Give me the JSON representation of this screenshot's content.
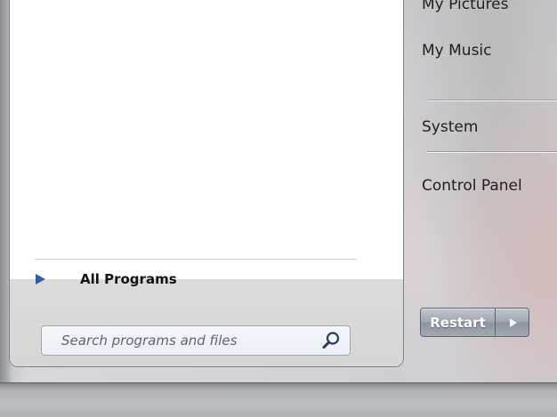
{
  "start_menu": {
    "all_programs_label": "All Programs",
    "search": {
      "placeholder": "Search programs and files",
      "value": ""
    },
    "right_items": {
      "my_pictures": "My Pictures",
      "my_music": "My Music",
      "system": "System",
      "control_panel": "Control Panel"
    },
    "restart_label": "Restart",
    "icons": {
      "all_programs_arrow": "triangle-right-icon",
      "search": "magnifier-icon",
      "restart_options": "triangle-right-icon"
    }
  },
  "colors": {
    "accent_arrow": "#2b5fa8",
    "separator": "#b9cfe0"
  }
}
